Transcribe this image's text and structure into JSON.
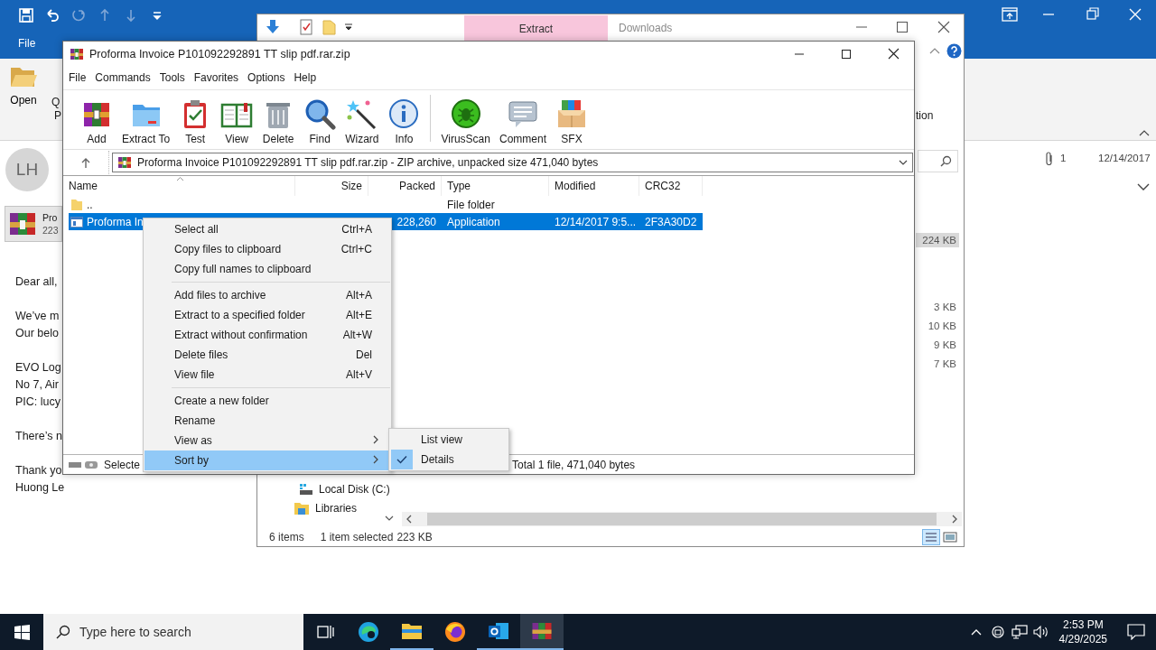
{
  "outlook": {
    "quick_access": [
      {
        "disabled": false
      },
      {
        "disabled": false
      },
      {
        "disabled": true
      },
      {
        "disabled": true
      },
      {
        "disabled": true
      },
      {
        "disabled": false
      }
    ],
    "file_tab": "File",
    "ribbon": {
      "open": "Open",
      "cut_1": "Q",
      "cut_2": "P"
    },
    "avatar": "LH",
    "attachment": {
      "name": "Pro",
      "size": "223"
    },
    "body": [
      [
        "Dear all,"
      ],
      [
        "We’ve m",
        "Our belo"
      ],
      [
        "EVO Log",
        "No 7, Air",
        "PIC: lucy"
      ],
      [
        "There’s n"
      ],
      [
        "Thank yo",
        "Huong Le"
      ]
    ],
    "attachment_count": "1",
    "date": "12/14/2017"
  },
  "explorer": {
    "tab": "Extract",
    "title": "Downloads",
    "ribbon_cut": "tion",
    "sizes": [
      {
        "text": "224 KB",
        "selected": true
      },
      {
        "text": "3 KB",
        "selected": false
      },
      {
        "text": "10 KB",
        "selected": false
      },
      {
        "text": "9 KB",
        "selected": false
      },
      {
        "text": "7 KB",
        "selected": false
      }
    ],
    "nav": [
      {
        "label": "Local Disk (C:)"
      },
      {
        "label": "Libraries"
      }
    ],
    "status": {
      "count": "6 items",
      "selection": "1 item selected",
      "size": "223 KB"
    }
  },
  "winrar": {
    "title": "Proforma Invoice P101092292891 TT slip pdf.rar.zip",
    "menu": [
      "File",
      "Commands",
      "Tools",
      "Favorites",
      "Options",
      "Help"
    ],
    "toolbar": [
      "Add",
      "Extract To",
      "Test",
      "View",
      "Delete",
      "Find",
      "Wizard",
      "Info",
      "VirusScan",
      "Comment",
      "SFX"
    ],
    "address": "Proforma Invoice P101092292891 TT slip pdf.rar.zip - ZIP archive, unpacked size 471,040 bytes",
    "columns": [
      "Name",
      "Size",
      "Packed",
      "Type",
      "Modified",
      "CRC32"
    ],
    "rows": [
      {
        "kind": "folder",
        "name": "..",
        "type": "File folder",
        "selected": false
      },
      {
        "kind": "file",
        "name": "Proforma In",
        "packed": "228,260",
        "type": "Application",
        "modified": "12/14/2017 9:5...",
        "crc32": "2F3A30D2",
        "selected": true
      }
    ],
    "status": {
      "left": "Selecte",
      "total": "Total 1 file, 471,040 bytes"
    }
  },
  "context_menu": {
    "groups": [
      [
        {
          "label": "Select all",
          "shortcut": "Ctrl+A",
          "submenu": false,
          "selected": false
        },
        {
          "label": "Copy files to clipboard",
          "shortcut": "Ctrl+C",
          "submenu": false,
          "selected": false
        },
        {
          "label": "Copy full names to clipboard",
          "submenu": false,
          "selected": false
        }
      ],
      [
        {
          "label": "Add files to archive",
          "shortcut": "Alt+A",
          "submenu": false,
          "selected": false
        },
        {
          "label": "Extract to a specified folder",
          "shortcut": "Alt+E",
          "submenu": false,
          "selected": false
        },
        {
          "label": "Extract without confirmation",
          "shortcut": "Alt+W",
          "submenu": false,
          "selected": false
        },
        {
          "label": "Delete files",
          "shortcut": "Del",
          "submenu": false,
          "selected": false
        },
        {
          "label": "View file",
          "shortcut": "Alt+V",
          "submenu": false,
          "selected": false
        }
      ],
      [
        {
          "label": "Create a new folder",
          "submenu": false,
          "selected": false
        },
        {
          "label": "Rename",
          "submenu": false,
          "selected": false
        },
        {
          "label": "View as",
          "submenu": true,
          "selected": false
        },
        {
          "label": "Sort by",
          "submenu": true,
          "selected": true
        }
      ]
    ]
  },
  "submenu": [
    {
      "label": "List view",
      "checked": false
    },
    {
      "label": "Details",
      "checked": true
    }
  ],
  "taskbar": {
    "search": "Type here to search",
    "apps": [
      {
        "running": false,
        "selected": false
      },
      {
        "running": true,
        "selected": false
      },
      {
        "running": false,
        "selected": false
      },
      {
        "running": true,
        "selected": false
      },
      {
        "running": true,
        "selected": true
      }
    ],
    "time": "2:53 PM",
    "date": "4/29/2025"
  }
}
